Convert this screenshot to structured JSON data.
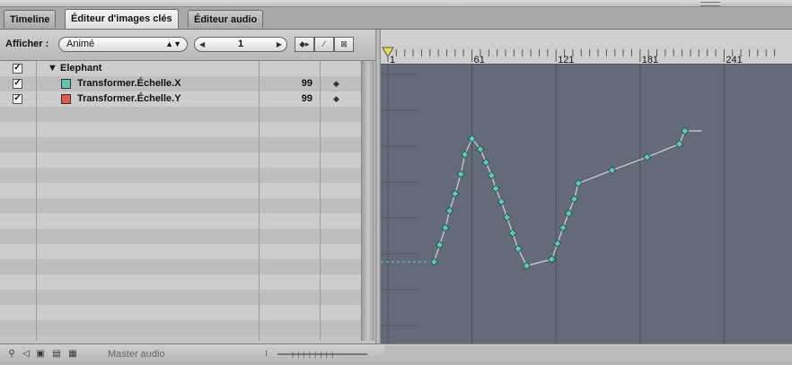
{
  "tabs": [
    "Timeline",
    "Éditeur d'images clés",
    "Éditeur audio"
  ],
  "active_tab": 1,
  "toolbar": {
    "show_label": "Afficher :",
    "show_value": "Animé",
    "frame_value": "1"
  },
  "tree": {
    "group": "Elephant",
    "params": [
      {
        "name": "Transformer.Échelle.X",
        "value": "99",
        "color": "#5ec9b0",
        "checked": true
      },
      {
        "name": "Transformer.Échelle.Y",
        "value": "99",
        "color": "#e2574d",
        "checked": true
      }
    ]
  },
  "footer": {
    "master_label": "Master audio"
  },
  "ruler": {
    "labels": [
      "1",
      "61",
      "121",
      "181",
      "241"
    ]
  },
  "curve": {
    "color": "#5ec9b0",
    "frames": [
      1,
      35,
      39,
      42,
      45,
      48,
      51,
      54,
      57,
      60,
      63,
      66,
      69,
      72,
      75,
      78,
      81,
      84,
      87,
      90,
      93,
      96,
      99,
      102,
      105,
      108,
      111,
      114,
      117,
      120,
      123,
      126,
      129,
      132,
      135,
      138,
      141,
      144,
      147,
      150,
      153,
      156,
      159,
      162,
      165,
      168,
      171,
      174,
      177,
      180,
      183,
      186,
      189,
      192,
      195,
      198,
      201,
      204,
      207,
      210,
      213,
      216,
      219,
      222,
      225,
      228,
      231,
      234,
      237,
      240,
      243,
      246,
      249,
      252,
      255,
      258
    ],
    "keyframes_approx": "curve drawn as polyline from keyframe list below",
    "points": [
      [
        34,
        0.0
      ],
      [
        38,
        0.13
      ],
      [
        42,
        0.26
      ],
      [
        45,
        0.39
      ],
      [
        49,
        0.52
      ],
      [
        53,
        0.67
      ],
      [
        56,
        0.82
      ],
      [
        61,
        0.94
      ],
      [
        67,
        0.86
      ],
      [
        71,
        0.76
      ],
      [
        75,
        0.66
      ],
      [
        78,
        0.56
      ],
      [
        82,
        0.46
      ],
      [
        86,
        0.34
      ],
      [
        90,
        0.22
      ],
      [
        94,
        0.1
      ],
      [
        100,
        -0.03
      ],
      [
        118,
        0.02
      ],
      [
        122,
        0.14
      ],
      [
        126,
        0.26
      ],
      [
        130,
        0.37
      ],
      [
        134,
        0.48
      ],
      [
        137,
        0.6
      ],
      [
        161,
        0.7
      ],
      [
        186,
        0.8
      ],
      [
        209,
        0.9
      ],
      [
        213,
        1.0
      ],
      [
        225,
        1.0
      ]
    ]
  }
}
